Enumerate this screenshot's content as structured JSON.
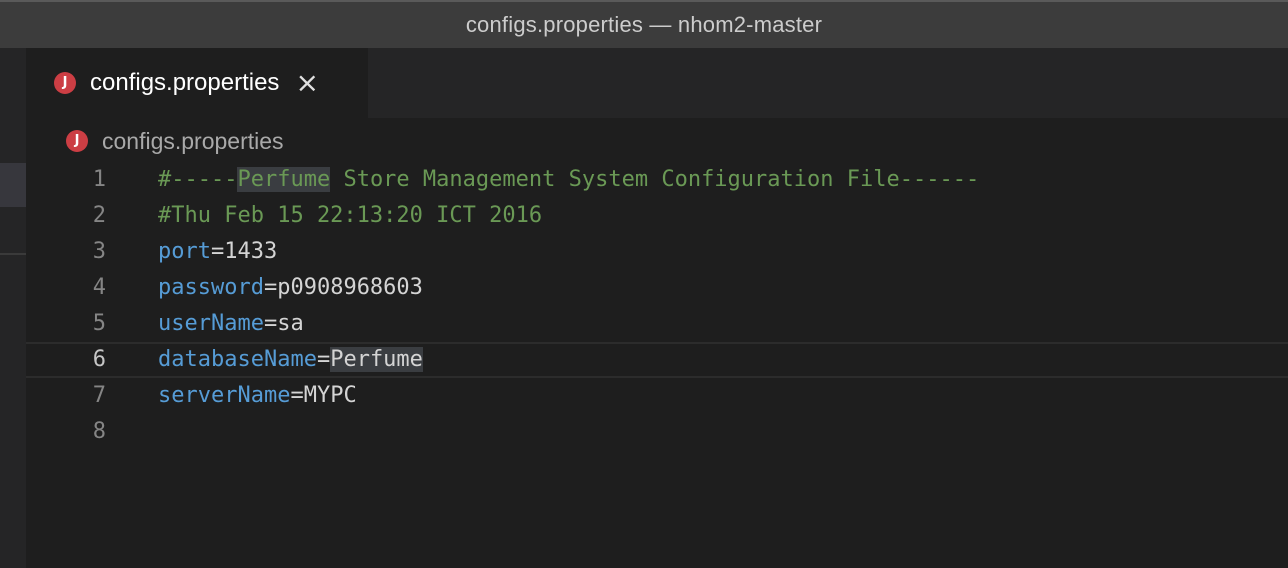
{
  "window": {
    "title": "configs.properties — nhom2-master"
  },
  "tabs": [
    {
      "icon": "J",
      "label": "configs.properties",
      "close": "×"
    }
  ],
  "breadcrumb": {
    "icon": "J",
    "label": "configs.properties"
  },
  "editor": {
    "current_line": 6,
    "lines": [
      {
        "number": "1",
        "pre": "#-----",
        "hl": "Perfume",
        "post": " Store Management System Configuration File------"
      },
      {
        "number": "2",
        "text": "#Thu Feb 15 22:13:20 ICT 2016"
      },
      {
        "number": "3",
        "key": "port",
        "sep": "=",
        "value": "1433"
      },
      {
        "number": "4",
        "key": "password",
        "sep": "=",
        "value": "p0908968603"
      },
      {
        "number": "5",
        "key": "userName",
        "sep": "=",
        "value": "sa"
      },
      {
        "number": "6",
        "key": "databaseName",
        "sep": "=",
        "value": "Perfume"
      },
      {
        "number": "7",
        "key": "serverName",
        "sep": "=",
        "value": "MYPC"
      },
      {
        "number": "8",
        "text": ""
      }
    ]
  },
  "colors": {
    "comment": "#6a9955",
    "key": "#569cd6",
    "value": "#d4d4d4",
    "file_icon": "#cc3e44"
  }
}
